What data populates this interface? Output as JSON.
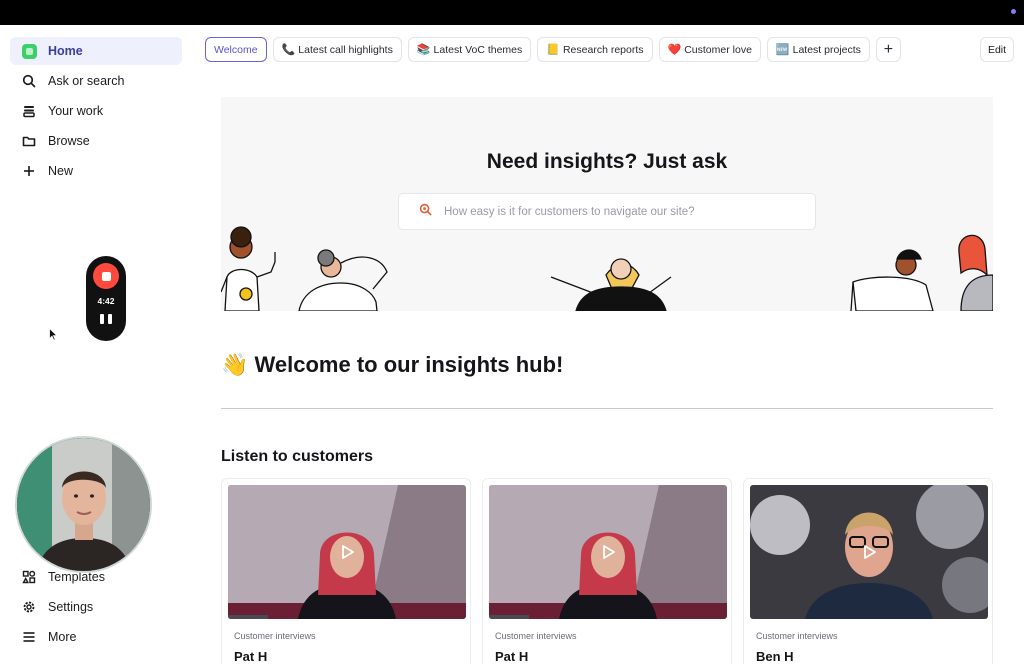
{
  "sidebar": {
    "top_items": [
      {
        "label": "Home",
        "icon": "home-icon"
      },
      {
        "label": "Ask or search",
        "icon": "search-icon"
      },
      {
        "label": "Your work",
        "icon": "stack-icon"
      },
      {
        "label": "Browse",
        "icon": "folder-icon"
      },
      {
        "label": "New",
        "icon": "plus-icon"
      }
    ],
    "bottom_items": [
      {
        "label": "Templates",
        "icon": "templates-icon"
      },
      {
        "label": "Settings",
        "icon": "gear-icon"
      },
      {
        "label": "More",
        "icon": "menu-icon"
      }
    ]
  },
  "recorder": {
    "time": "4:42"
  },
  "tabs": [
    {
      "label": "Welcome",
      "emoji": ""
    },
    {
      "label": "Latest call highlights",
      "emoji": "📞"
    },
    {
      "label": "Latest VoC themes",
      "emoji": "📚"
    },
    {
      "label": "Research reports",
      "emoji": "📒"
    },
    {
      "label": "Customer love",
      "emoji": "❤️"
    },
    {
      "label": "Latest projects",
      "emoji": "🆕"
    }
  ],
  "tab_add_label": "+",
  "edit_label": "Edit",
  "hero": {
    "title": "Need insights? Just ask",
    "search_placeholder": "How easy is it for customers to navigate our site?"
  },
  "welcome": {
    "emoji": "👋",
    "title": "Welcome to our insights hub!"
  },
  "section_title": "Listen to customers",
  "cards": [
    {
      "category": "Customer interviews",
      "name": "Pat H"
    },
    {
      "category": "Customer interviews",
      "name": "Pat H"
    },
    {
      "category": "Customer interviews",
      "name": "Ben H"
    }
  ],
  "colors": {
    "accent": "#5a52c9",
    "record": "#ff4a3d",
    "home_green": "#3ecf6b"
  }
}
